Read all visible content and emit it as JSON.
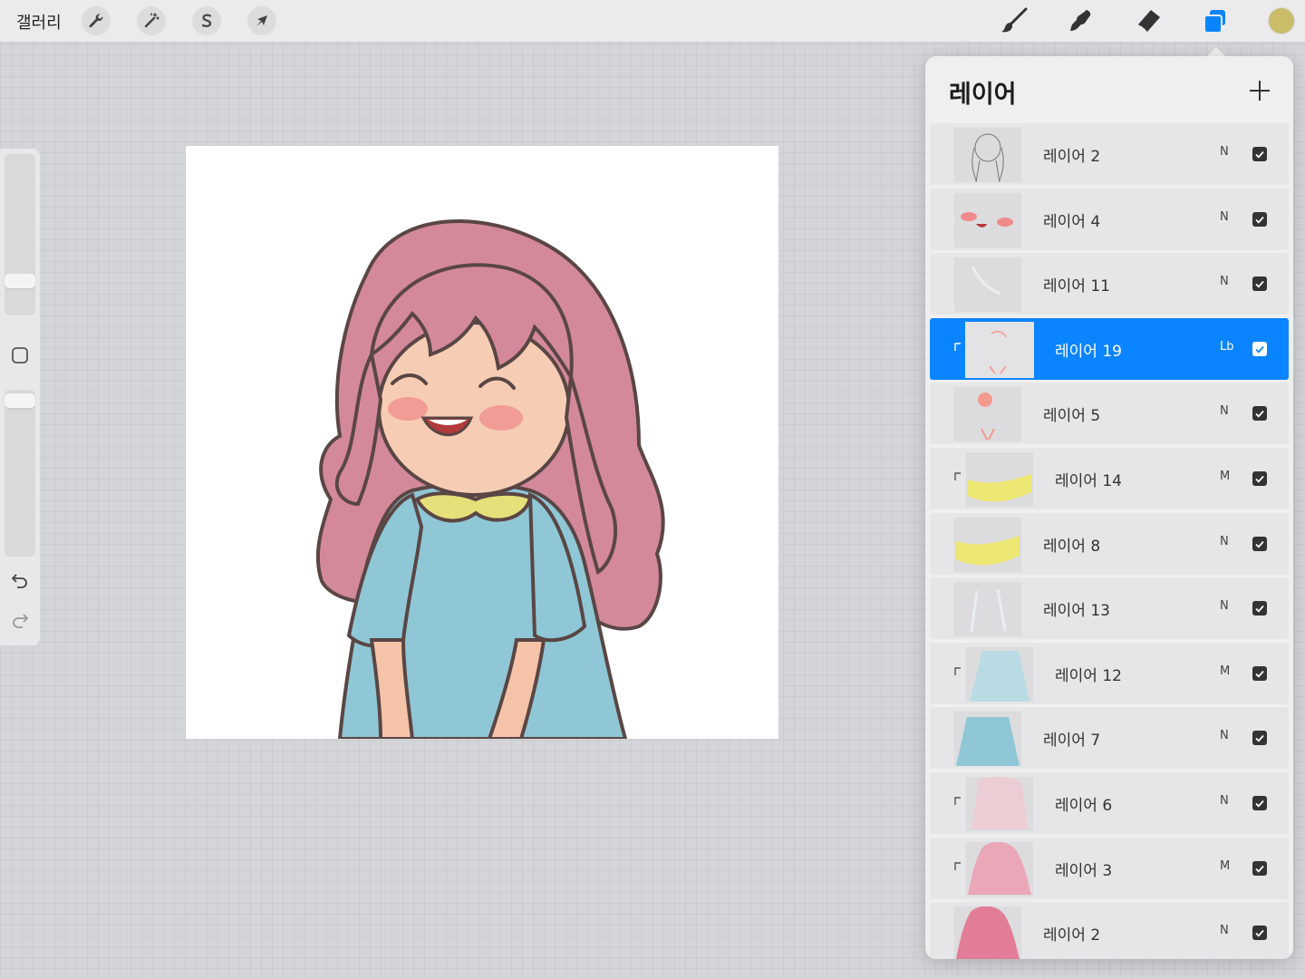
{
  "topbar": {
    "gallery_label": "갤러리",
    "left_tools": [
      "wrench-icon",
      "magic-wand-icon",
      "selection-s-icon",
      "arrow-cursor-icon"
    ],
    "right_tools": [
      "brush-icon",
      "smudge-icon",
      "eraser-icon",
      "layers-icon"
    ],
    "active_color": "#c9bd6a",
    "accent": "#0a84ff"
  },
  "sidebar": {
    "brush_size_level": 0.25,
    "opacity_level": 0.93
  },
  "layers_panel": {
    "title": "레이어",
    "layers": [
      {
        "name": "레이어 2",
        "blend": "N",
        "clipped": false,
        "selected": false,
        "visible": true
      },
      {
        "name": "레이어 4",
        "blend": "N",
        "clipped": false,
        "selected": false,
        "visible": true
      },
      {
        "name": "레이어 11",
        "blend": "N",
        "clipped": false,
        "selected": false,
        "visible": true
      },
      {
        "name": "레이어 19",
        "blend": "Lb",
        "clipped": true,
        "selected": true,
        "visible": true
      },
      {
        "name": "레이어 5",
        "blend": "N",
        "clipped": false,
        "selected": false,
        "visible": true
      },
      {
        "name": "레이어 14",
        "blend": "M",
        "clipped": true,
        "selected": false,
        "visible": true
      },
      {
        "name": "레이어 8",
        "blend": "N",
        "clipped": false,
        "selected": false,
        "visible": true
      },
      {
        "name": "레이어 13",
        "blend": "N",
        "clipped": false,
        "selected": false,
        "visible": true
      },
      {
        "name": "레이어 12",
        "blend": "M",
        "clipped": true,
        "selected": false,
        "visible": true
      },
      {
        "name": "레이어 7",
        "blend": "N",
        "clipped": false,
        "selected": false,
        "visible": true
      },
      {
        "name": "레이어 6",
        "blend": "N",
        "clipped": true,
        "selected": false,
        "visible": true
      },
      {
        "name": "레이어 3",
        "blend": "M",
        "clipped": true,
        "selected": false,
        "visible": true
      },
      {
        "name": "레이어 2",
        "blend": "N",
        "clipped": false,
        "selected": false,
        "visible": true
      }
    ]
  }
}
